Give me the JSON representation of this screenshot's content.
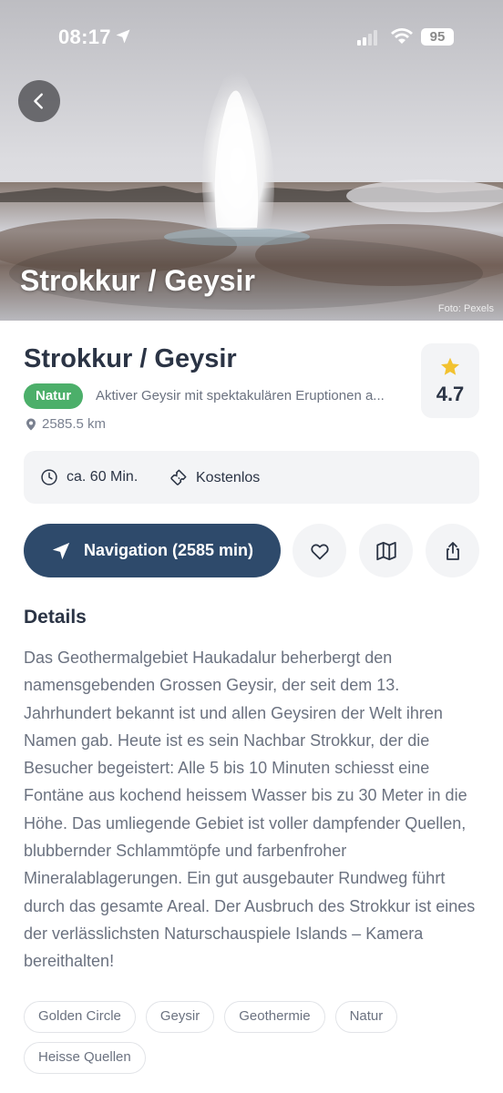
{
  "status_bar": {
    "time": "08:17",
    "battery": "95"
  },
  "hero": {
    "title": "Strokkur / Geysir",
    "photo_credit": "Foto: Pexels"
  },
  "place": {
    "title": "Strokkur / Geysir",
    "category": "Natur",
    "tagline": "Aktiver Geysir mit spektakulären Eruptionen a...",
    "distance": "2585.5 km",
    "rating": "4.7"
  },
  "info": {
    "duration": "ca. 60 Min.",
    "price": "Kostenlos"
  },
  "actions": {
    "navigation_label": "Navigation (2585 min)"
  },
  "details": {
    "heading": "Details",
    "text": "Das Geothermalgebiet Haukadalur beherbergt den namensgebenden Grossen Geysir, der seit dem 13. Jahrhundert bekannt ist und allen Geysiren der Welt ihren Namen gab. Heute ist es sein Nachbar Strokkur, der die Besucher begeistert: Alle 5 bis 10 Minuten schiesst eine Fontäne aus kochend heissem Wasser bis zu 30 Meter in die Höhe. Das umliegende Gebiet ist voller dampfender Quellen, blubbernder Schlammtöpfe und farbenfroher Mineralablagerungen. Ein gut ausgebauter Rundweg führt durch das gesamte Areal. Der Ausbruch des Strokkur ist eines der verlässlichsten Naturschauspiele Islands – Kamera bereithalten!"
  },
  "tags": [
    "Golden Circle",
    "Geysir",
    "Geothermie",
    "Natur",
    "Heisse Quellen"
  ],
  "colors": {
    "primary": "#2e4a6b",
    "category_badge": "#4caf6a",
    "star": "#f2c230",
    "text_dark": "#2b3445",
    "text_muted": "#6b7280"
  },
  "icons": {
    "back": "chevron-left-icon",
    "location": "navigation-arrow-icon",
    "pin": "map-pin-icon",
    "clock": "clock-icon",
    "ticket": "ticket-icon",
    "favorite": "heart-icon",
    "map": "map-icon",
    "share": "share-icon",
    "star": "star-icon"
  }
}
